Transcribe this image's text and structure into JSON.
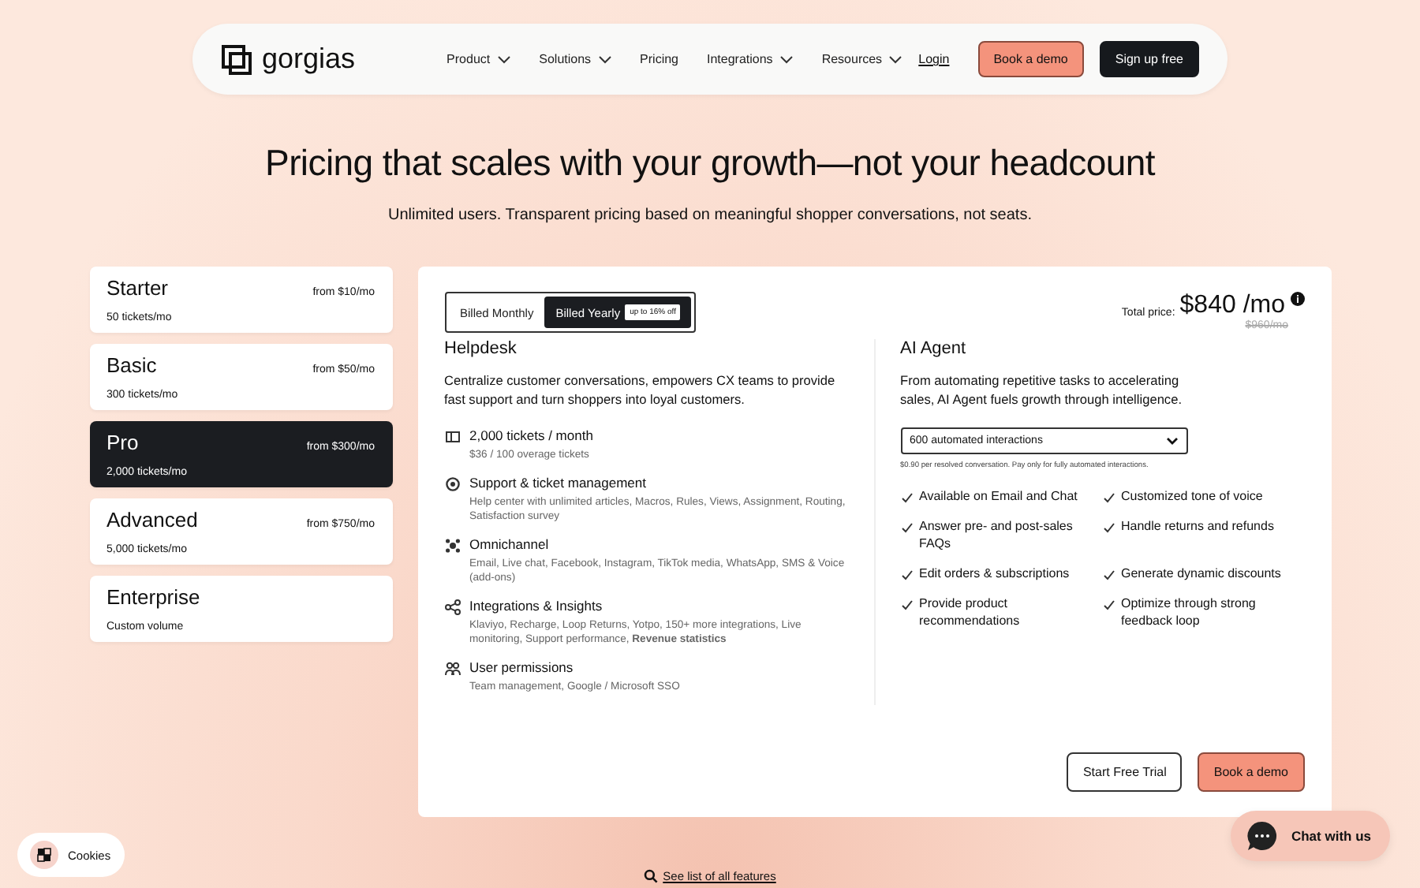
{
  "nav": {
    "logo": "gorgias",
    "links": [
      {
        "label": "Product",
        "dropdown": true
      },
      {
        "label": "Solutions",
        "dropdown": true
      },
      {
        "label": "Pricing",
        "dropdown": false
      },
      {
        "label": "Integrations",
        "dropdown": true
      },
      {
        "label": "Resources",
        "dropdown": true
      }
    ],
    "login": "Login",
    "demo": "Book a demo",
    "signup": "Sign up free"
  },
  "heading": "Pricing that scales with your growth—not your headcount",
  "subheading": "Unlimited users. Transparent pricing based on meaningful shopper conversations, not seats.",
  "plans": [
    {
      "name": "Starter",
      "price": "from $10/mo",
      "volume": "50 tickets/mo",
      "selected": false
    },
    {
      "name": "Basic",
      "price": "from $50/mo",
      "volume": "300 tickets/mo",
      "selected": false
    },
    {
      "name": "Pro",
      "price": "from $300/mo",
      "volume": "2,000 tickets/mo",
      "selected": true
    },
    {
      "name": "Advanced",
      "price": "from $750/mo",
      "volume": "5,000 tickets/mo",
      "selected": false
    },
    {
      "name": "Enterprise",
      "volume": "Custom volume",
      "selected": false
    }
  ],
  "billing": [
    {
      "label": "Billed Monthly",
      "selected": false
    },
    {
      "label": "Billed Yearly",
      "badge": "up to 16% off",
      "selected": true
    }
  ],
  "total": {
    "label": "Total price:",
    "price": "$840 /mo",
    "old_price": "$960/mo"
  },
  "helpdesk": {
    "title": "Helpdesk",
    "description": "Centralize customer conversations, empowers CX teams to provide fast support and turn shoppers into loyal customers.",
    "features": [
      {
        "kind": "tickets",
        "title": "2,000 tickets / month",
        "detail": "$36 / 100 overage tickets"
      },
      {
        "kind": "support",
        "title": "Support & ticket management",
        "detail": "Help center with unlimited articles, Macros, Rules, Views, Assignment, Routing, Satisfaction survey"
      },
      {
        "kind": "channels",
        "title": "Omnichannel",
        "detail": "Email, Live chat, Facebook, Instagram, TikTok media, WhatsApp, SMS & Voice (add-ons)"
      },
      {
        "kind": "integrations",
        "title": "Integrations & Insights",
        "detail": "Klaviyo, Recharge, Loop Returns, Yotpo, 150+ more integrations, Live monitoring, Support performance, **Revenue statistics**"
      },
      {
        "kind": "users",
        "title": "User permissions",
        "detail": "Team management, Google / Microsoft SSO"
      }
    ]
  },
  "ai_agent": {
    "title": "AI Agent",
    "description": "From automating repetitive tasks to accelerating sales, AI Agent fuels growth through intelligence.",
    "select": "600 automated interactions",
    "note": "$0.90 per resolved conversation. Pay only for fully automated interactions.",
    "features": [
      "Available on Email and Chat",
      "Customized tone of voice",
      "Answer pre- and post-sales FAQs",
      "Handle returns and refunds",
      "Edit orders & subscriptions",
      "Generate dynamic discounts",
      "Provide product recommendations",
      "Optimize through strong feedback loop"
    ]
  },
  "actions": {
    "trial": "Start Free Trial",
    "demo": "Book a demo"
  },
  "features_link": "See list of all features",
  "cookies": "Cookies",
  "chat": "Chat with us"
}
